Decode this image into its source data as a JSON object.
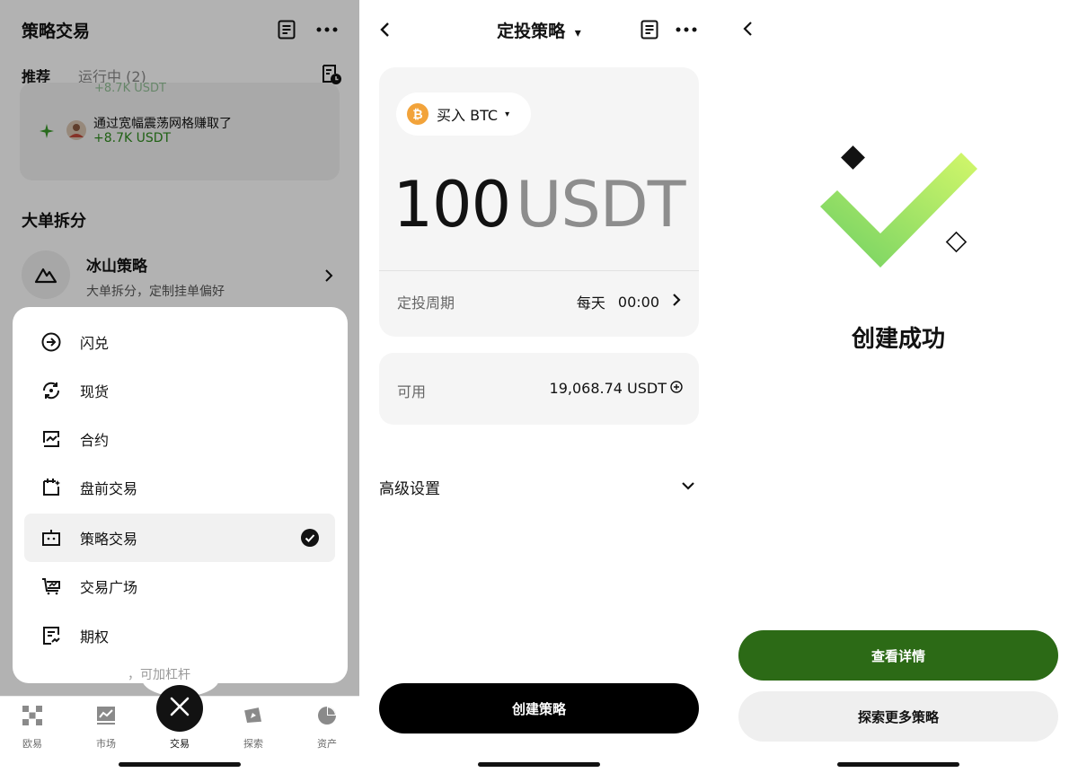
{
  "left": {
    "header": {
      "title": "策略交易",
      "doc_icon": "doc-icon",
      "more_icon": "more-icon"
    },
    "tabs": [
      {
        "label": "推荐",
        "active": true
      },
      {
        "label": "运行中 (2)",
        "active": false
      }
    ],
    "history_icon": "doc-clock-icon",
    "feed": {
      "prev_value": "+8.7K USDT",
      "title": "通过宽幅震荡网格赚取了",
      "value": "+8.7K USDT"
    },
    "section_title": "大单拆分",
    "iceberg": {
      "name": "冰山策略",
      "desc": "大单拆分，定制挂单偏好"
    },
    "menu": {
      "items": [
        {
          "label": "闪兑",
          "icon": "swap-icon"
        },
        {
          "label": "现货",
          "icon": "spot-icon"
        },
        {
          "label": "合约",
          "icon": "futures-icon"
        },
        {
          "label": "盘前交易",
          "icon": "premarket-icon"
        },
        {
          "label": "策略交易",
          "icon": "bot-icon",
          "selected": true
        },
        {
          "label": "交易广场",
          "icon": "market-icon"
        },
        {
          "label": "期权",
          "icon": "options-icon"
        }
      ]
    },
    "behind_text": "，可加杠杆",
    "tabbar": [
      {
        "label": "欧易",
        "icon": "okx-logo-icon"
      },
      {
        "label": "市场",
        "icon": "chart-icon"
      },
      {
        "label": "交易",
        "icon": "close-icon"
      },
      {
        "label": "探索",
        "icon": "compass-icon"
      },
      {
        "label": "资产",
        "icon": "pie-icon"
      }
    ]
  },
  "middle": {
    "header": {
      "title": "定投策略",
      "title_caret": "▾"
    },
    "coin_pill": {
      "coin_symbol": "₿",
      "label": "买入 BTC",
      "caret": "▾"
    },
    "amount": {
      "value": "100",
      "currency": "USDT"
    },
    "period": {
      "label": "定投周期",
      "frequency": "每天",
      "time": "00:00"
    },
    "available": {
      "label": "可用",
      "value": "19,068.74 USDT"
    },
    "advanced": {
      "label": "高级设置"
    },
    "create_button": "创建策略"
  },
  "right": {
    "success_text": "创建成功",
    "view_details_button": "查看详情",
    "explore_button": "探索更多策略",
    "colors": {
      "primary_green": "#2c6a16",
      "check_light": "#c9f36a",
      "check_dark": "#6fd063"
    }
  }
}
